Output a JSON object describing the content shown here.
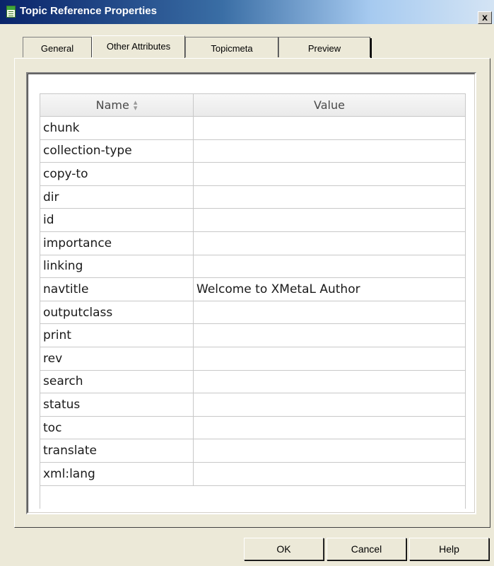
{
  "window": {
    "title": "Topic Reference Properties",
    "close_label": "x"
  },
  "tabs": [
    {
      "label": "General",
      "active": false
    },
    {
      "label": "Other Attributes",
      "active": true
    },
    {
      "label": "Topicmeta",
      "active": false
    },
    {
      "label": "Preview",
      "active": false
    }
  ],
  "grid": {
    "columns": {
      "name": "Name",
      "value": "Value"
    },
    "sort_icon": "sort-up-down-icon",
    "rows": [
      {
        "name": "chunk",
        "value": ""
      },
      {
        "name": "collection-type",
        "value": ""
      },
      {
        "name": "copy-to",
        "value": ""
      },
      {
        "name": "dir",
        "value": ""
      },
      {
        "name": "id",
        "value": ""
      },
      {
        "name": "importance",
        "value": ""
      },
      {
        "name": "linking",
        "value": ""
      },
      {
        "name": "navtitle",
        "value": "Welcome to XMetaL Author"
      },
      {
        "name": "outputclass",
        "value": ""
      },
      {
        "name": "print",
        "value": ""
      },
      {
        "name": "rev",
        "value": ""
      },
      {
        "name": "search",
        "value": ""
      },
      {
        "name": "status",
        "value": ""
      },
      {
        "name": "toc",
        "value": ""
      },
      {
        "name": "translate",
        "value": ""
      },
      {
        "name": "xml:lang",
        "value": ""
      }
    ]
  },
  "buttons": {
    "ok": "OK",
    "cancel": "Cancel",
    "help": "Help"
  }
}
